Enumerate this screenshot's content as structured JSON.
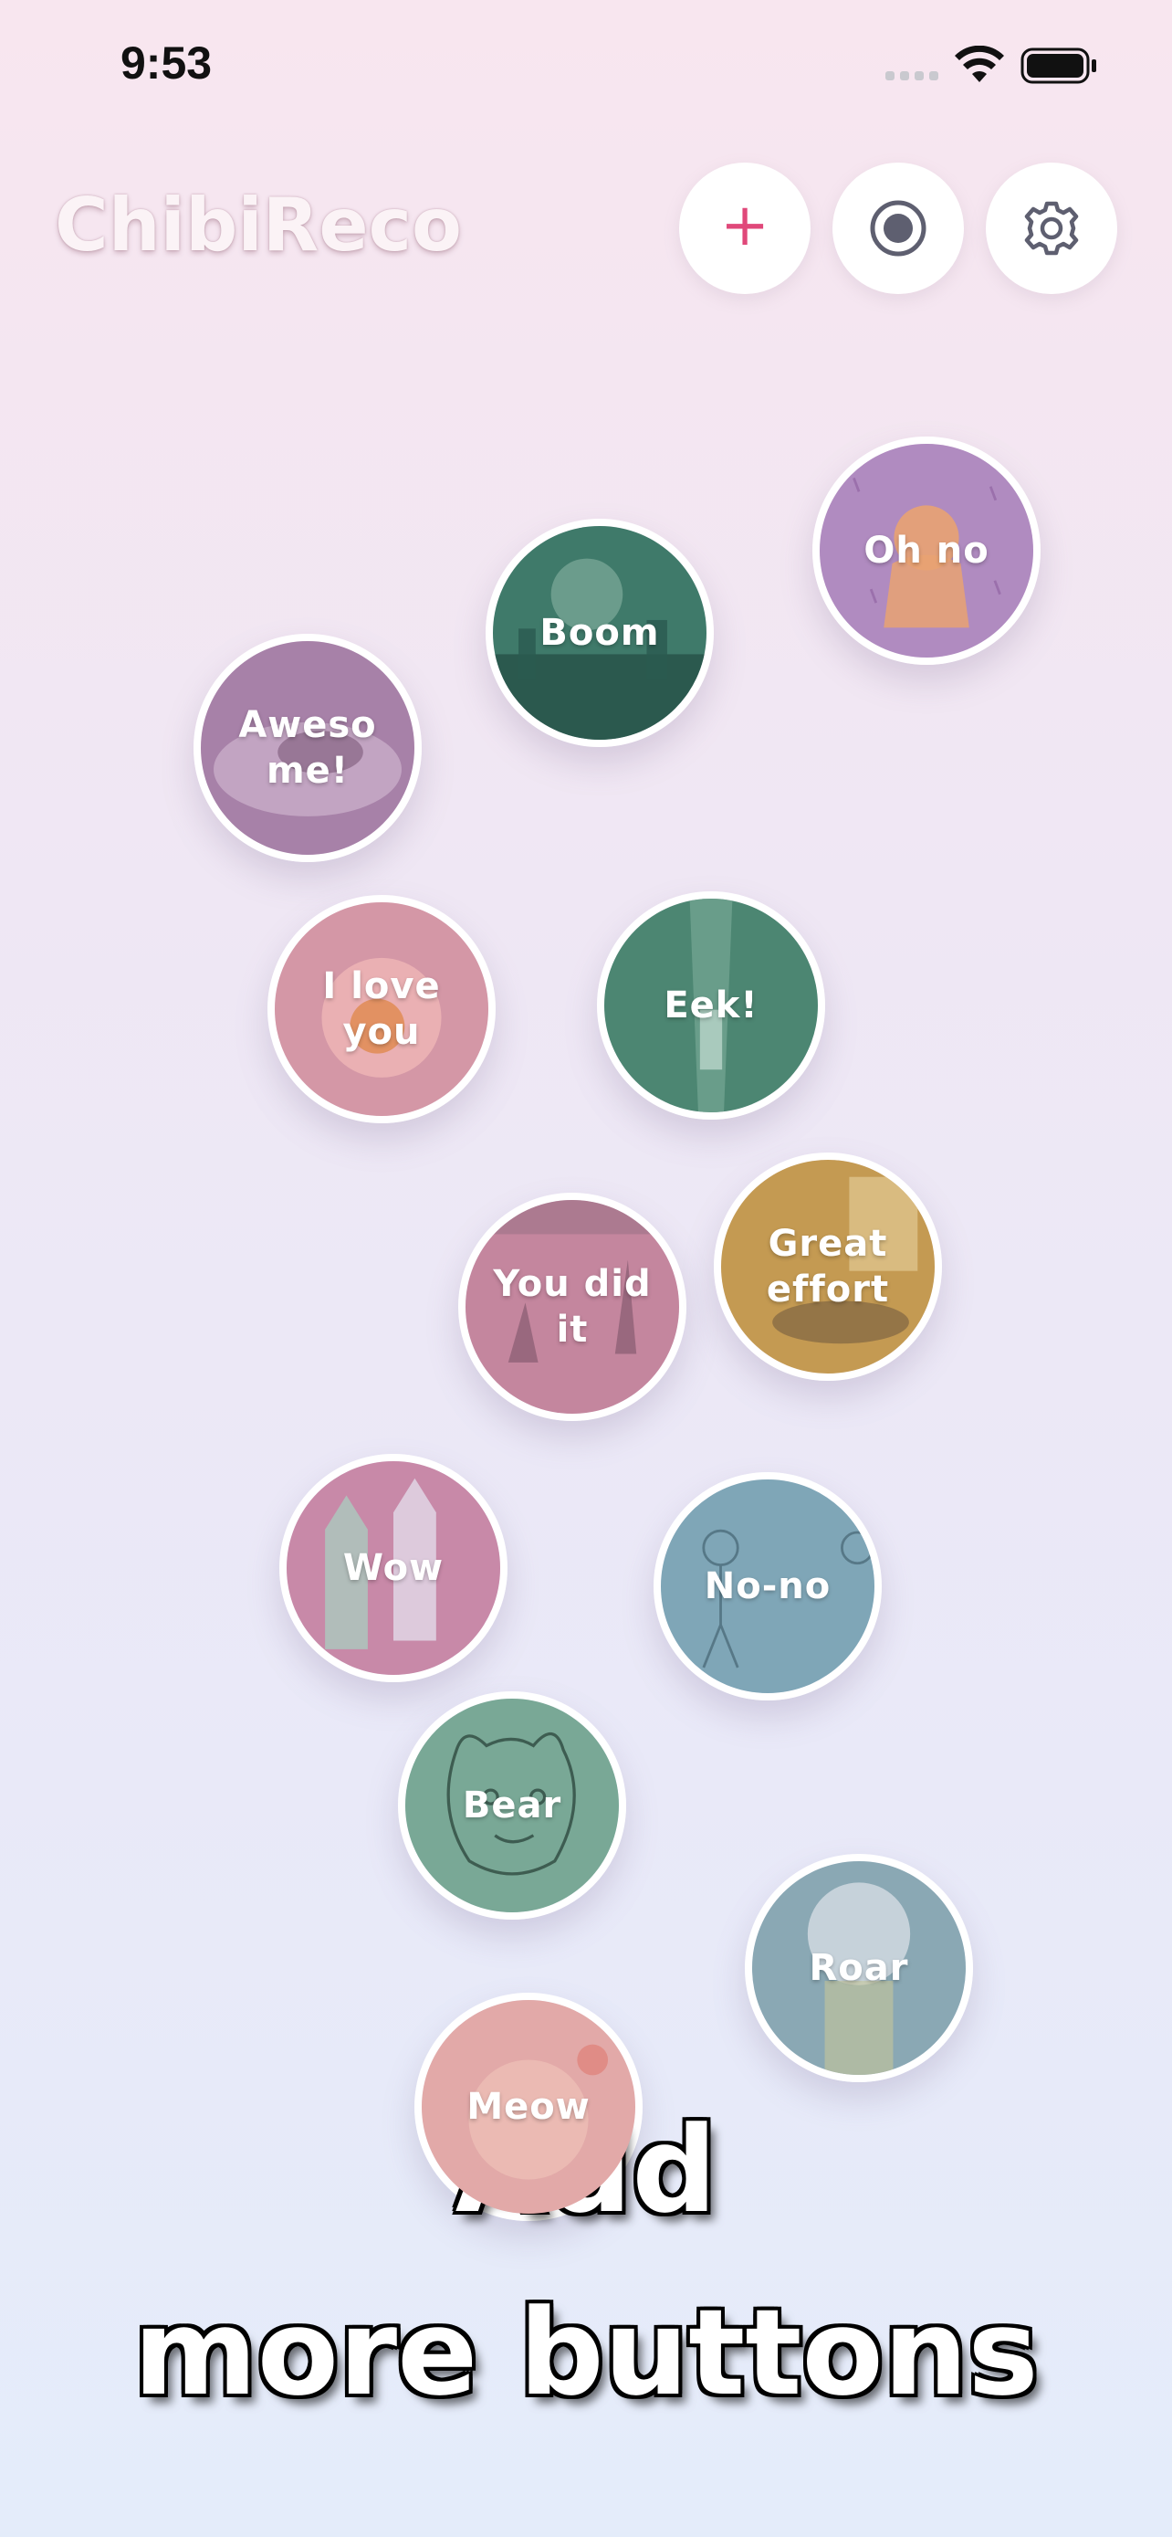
{
  "status": {
    "time": "9:53"
  },
  "app": {
    "title": "ChibiReco"
  },
  "toolbar": {
    "add_icon": "plus-icon",
    "record_icon": "record-icon",
    "settings_icon": "gear-icon"
  },
  "buttons": [
    {
      "label": "Oh no",
      "color": "#b08bc0"
    },
    {
      "label": "Boom",
      "color": "#3f7a6a"
    },
    {
      "label": "Aweso\nme!",
      "color": "#a781a8"
    },
    {
      "label": "I love\nyou",
      "color": "#d497a6"
    },
    {
      "label": "Eek!",
      "color": "#4c8672"
    },
    {
      "label": "You did\nit",
      "color": "#c4869e"
    },
    {
      "label": "Great\neffort",
      "color": "#c49a52"
    },
    {
      "label": "Wow",
      "color": "#c889a8"
    },
    {
      "label": "No-no",
      "color": "#7fa6b7"
    },
    {
      "label": "Bear",
      "color": "#79a896"
    },
    {
      "label": "Roar",
      "color": "#8aa8b4"
    },
    {
      "label": "Meow",
      "color": "#e2a9a8"
    }
  ],
  "promo": {
    "line1": "Add",
    "line2": "more buttons"
  }
}
